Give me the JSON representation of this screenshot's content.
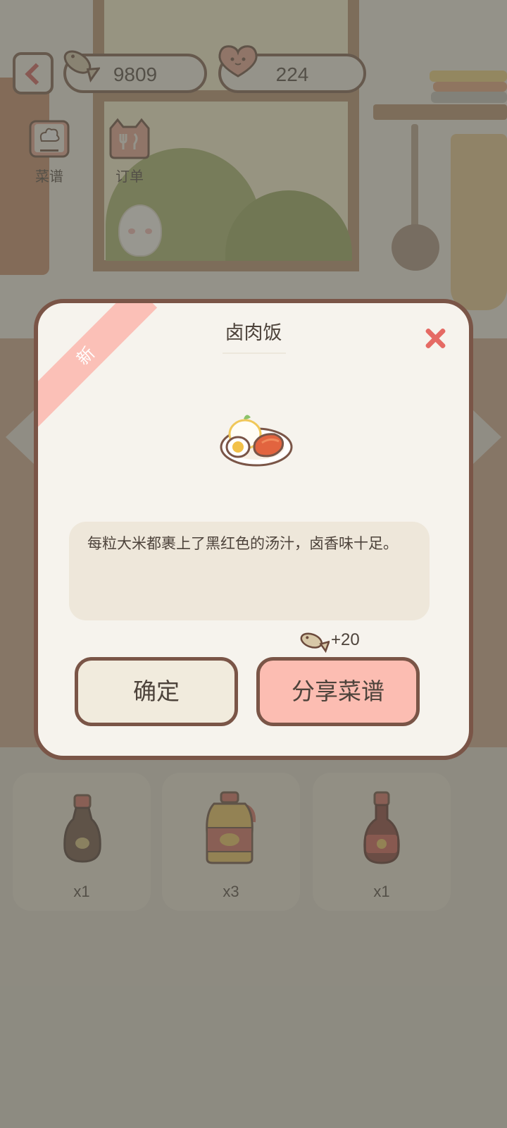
{
  "hud": {
    "fish_coins": "9809",
    "hearts": "224"
  },
  "menu": {
    "recipes_label": "菜谱",
    "orders_label": "订单"
  },
  "dialog": {
    "badge": "新",
    "title": "卤肉饭",
    "description": "每粒大米都裹上了黑红色的汤汁，卤香味十足。",
    "reward": "+20",
    "confirm_label": "确定",
    "share_label": "分享菜谱"
  },
  "inventory": [
    {
      "item_icon": "soy-sauce-bottle-icon",
      "count": "x1"
    },
    {
      "item_icon": "cooking-oil-jug-icon",
      "count": "x3"
    },
    {
      "item_icon": "vinegar-bottle-icon",
      "count": "x1"
    }
  ],
  "colors": {
    "accent_red": "#e56a64",
    "share_button": "#fcbdb2",
    "border_brown": "#7a5547",
    "ribbon_pink": "#fbc0b7"
  }
}
